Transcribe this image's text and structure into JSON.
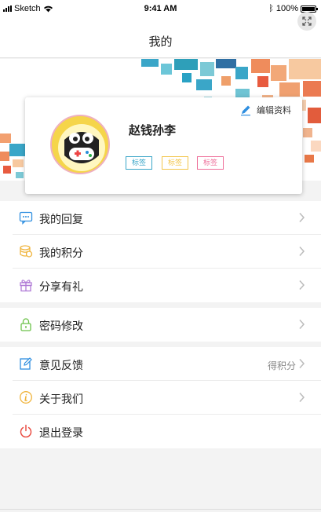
{
  "status_bar": {
    "carrier": "Sketch",
    "time": "9:41 AM",
    "battery": "100%"
  },
  "nav": {
    "title": "我的"
  },
  "profile": {
    "name": "赵钱孙李",
    "edit_label": "编辑资料",
    "tags": [
      {
        "label": "标签",
        "color": "#3aa6c8"
      },
      {
        "label": "标签",
        "color": "#f3c54a"
      },
      {
        "label": "标签",
        "color": "#ee6f9a"
      }
    ]
  },
  "menu_groups": [
    {
      "items": [
        {
          "icon": "message-icon",
          "label": "我的回复"
        },
        {
          "icon": "coins-icon",
          "label": "我的积分"
        },
        {
          "icon": "gift-icon",
          "label": "分享有礼"
        }
      ]
    },
    {
      "items": [
        {
          "icon": "lock-icon",
          "label": "密码修改"
        }
      ]
    },
    {
      "items": [
        {
          "icon": "feedback-edit-icon",
          "label": "意见反馈",
          "extra": "得积分"
        },
        {
          "icon": "info-icon",
          "label": "关于我们"
        },
        {
          "icon": "power-icon",
          "label": "退出登录"
        }
      ]
    }
  ],
  "colors": {
    "accent_blue": "#2f8fe0",
    "tag_blue": "#3aa6c8",
    "tag_yellow": "#f3c54a",
    "tag_pink": "#ee6f9a",
    "logout_red": "#e9453b"
  }
}
